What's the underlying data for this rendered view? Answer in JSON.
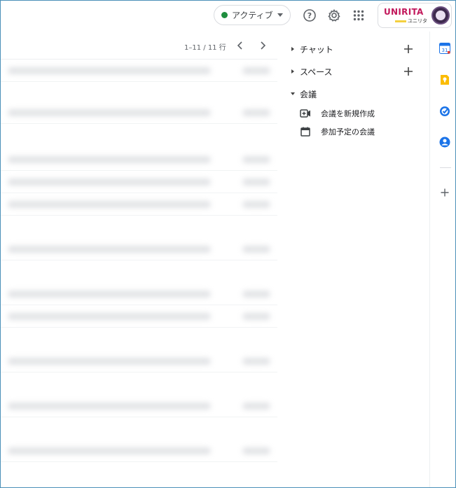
{
  "header": {
    "status_label": "アクティブ",
    "status_color": "#1e8e3e",
    "icons": [
      "help-icon",
      "settings-icon",
      "apps-grid-icon"
    ],
    "account": {
      "brand_text": "UNIRITA",
      "brand_sub": "ユニリタ",
      "brand_color": "#c2185b"
    }
  },
  "mail": {
    "pagination": "1–11 / 11 行",
    "prev_icon": "chevron-left-icon",
    "next_icon": "chevron-right-icon"
  },
  "panel": {
    "chat": {
      "label": "チャット",
      "expanded": false
    },
    "spaces": {
      "label": "スペース",
      "expanded": false
    },
    "meet": {
      "label": "会議",
      "expanded": true,
      "items": [
        {
          "label": "会議を新規作成",
          "icon": "video-add-icon"
        },
        {
          "label": "参加予定の会議",
          "icon": "calendar-icon"
        }
      ]
    }
  },
  "rail": {
    "apps": [
      "calendar-app-icon",
      "keep-app-icon",
      "tasks-app-icon",
      "contacts-app-icon"
    ],
    "add_icon": "add-icon",
    "calendar_day": "31"
  }
}
